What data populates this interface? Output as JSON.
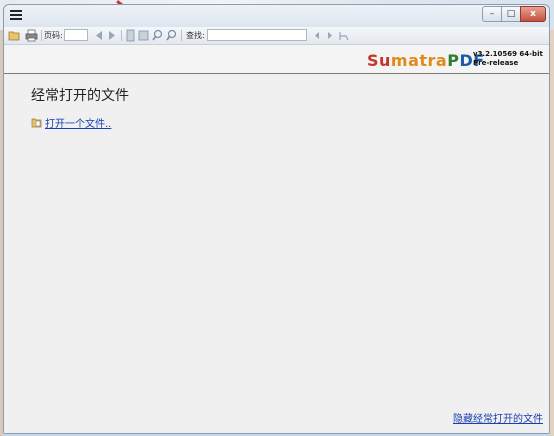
{
  "app": {
    "menu_icon": "hamburger-icon",
    "window_controls": {
      "minimize": "–",
      "maximize": "□",
      "close": "x"
    }
  },
  "toolbar": {
    "page_label": "页码:",
    "find_label": "查找:",
    "page_value": "",
    "find_value": "",
    "icons": [
      "open-icon",
      "print-icon",
      "prev-page-icon",
      "next-page-icon",
      "fit-page-icon",
      "fit-width-icon",
      "zoom-out-icon",
      "zoom-in-icon",
      "find-prev-icon",
      "find-next-icon",
      "match-case-icon"
    ]
  },
  "brand": {
    "name_parts": [
      "Su",
      "matra",
      "P",
      "DF"
    ],
    "version": "v3.2.10569 64-bit",
    "channel": "Pre-release",
    "colors": {
      "s": "#c0392b",
      "matra": "#e08a1b",
      "p": "#2e7d32",
      "df": "#1f5aa6"
    }
  },
  "main": {
    "heading": "经常打开的文件",
    "open_link": "打开一个文件..",
    "hide_link": "隐藏经常打开的文件"
  }
}
